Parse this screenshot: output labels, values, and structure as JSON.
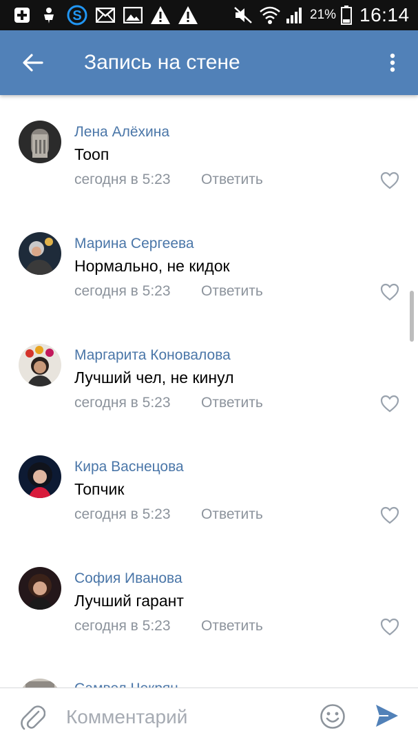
{
  "status_bar": {
    "icons": [
      "add-notification-icon",
      "usb-debug-icon",
      "skype-icon",
      "mail-icon",
      "gallery-icon",
      "warning-icon",
      "warning-icon",
      "mute-icon",
      "wifi-icon",
      "signal-icon",
      "battery-icon"
    ],
    "battery": "21%",
    "time": "16:14"
  },
  "toolbar": {
    "title": "Запись на стене",
    "back_icon": "arrow-left-icon",
    "menu_icon": "more-vertical-icon"
  },
  "comments": [
    {
      "author": "Лена Алёхина",
      "text": "Тооп",
      "time": "сегодня в 5:23",
      "reply": "Ответить"
    },
    {
      "author": "Марина Сергеева",
      "text": "Нормально, не кидок",
      "time": "сегодня в 5:23",
      "reply": "Ответить"
    },
    {
      "author": "Маргарита Коновалова",
      "text": "Лучший чел, не кинул",
      "time": "сегодня в 5:23",
      "reply": "Ответить"
    },
    {
      "author": "Кира Васнецова",
      "text": "Топчик",
      "time": "сегодня в 5:23",
      "reply": "Ответить"
    },
    {
      "author": "София Иванова",
      "text": "Лучший гарант",
      "time": "сегодня в 5:23",
      "reply": "Ответить"
    },
    {
      "author": "Самвел Чекрян",
      "text": "",
      "time": "",
      "reply": ""
    }
  ],
  "input": {
    "placeholder": "Комментарий",
    "value": ""
  },
  "colors": {
    "accent": "#5181b8",
    "author": "#4a76a8",
    "secondary_text": "#8c939c",
    "send": "#5181b8"
  }
}
